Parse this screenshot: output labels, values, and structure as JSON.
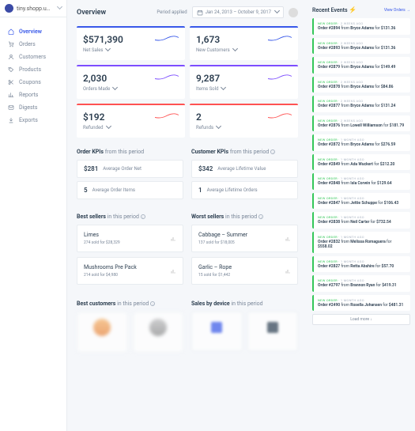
{
  "site": "tiny.shopp.u…",
  "nav": [
    {
      "label": "Overview",
      "icon": "home"
    },
    {
      "label": "Orders",
      "icon": "cart"
    },
    {
      "label": "Customers",
      "icon": "user"
    },
    {
      "label": "Products",
      "icon": "tag"
    },
    {
      "label": "Coupons",
      "icon": "cut"
    },
    {
      "label": "Reports",
      "icon": "chart"
    },
    {
      "label": "Digests",
      "icon": "mail"
    },
    {
      "label": "Exports",
      "icon": "download"
    }
  ],
  "header": {
    "title": "Overview",
    "period_label": "Period applied",
    "date_range": "Jan 24, 2013 – October 9, 2017"
  },
  "chart_data": {
    "type": "table",
    "title": "Overview metrics",
    "series": [
      {
        "name": "Net Sales",
        "value": 571390,
        "display": "$571,390",
        "color": "#3858e9"
      },
      {
        "name": "New Customers",
        "value": 1673,
        "display": "1,673",
        "color": "#3858e9"
      },
      {
        "name": "Orders Made",
        "value": 2030,
        "display": "2,030",
        "color": "#7c4dff"
      },
      {
        "name": "Items Sold",
        "value": 9287,
        "display": "9,287",
        "color": "#7c4dff"
      },
      {
        "name": "Refunded",
        "value": 192,
        "display": "$192",
        "color": "#ff5252"
      },
      {
        "name": "Refunds",
        "value": 2,
        "display": "2",
        "color": "#ff5252"
      }
    ]
  },
  "sections": {
    "order_kpis": {
      "title": "Order KPIs",
      "sub": "from this period",
      "items": [
        {
          "val": "$281",
          "lbl": "Average Order Net"
        },
        {
          "val": "5",
          "lbl": "Average Order Items"
        }
      ]
    },
    "customer_kpis": {
      "title": "Customer KPIs",
      "sub": "from this period",
      "items": [
        {
          "val": "$342",
          "lbl": "Average Lifetime Value"
        },
        {
          "val": "1",
          "lbl": "Average Lifetime Orders"
        }
      ]
    },
    "best_sellers": {
      "title": "Best sellers",
      "sub": "in this period",
      "items": [
        {
          "name": "Limes",
          "stat": "274 sold for $28,329"
        },
        {
          "name": "Mushrooms Pre Pack",
          "stat": "214 sold for $4,980"
        }
      ]
    },
    "worst_sellers": {
      "title": "Worst sellers",
      "sub": "in this period",
      "items": [
        {
          "name": "Cabbage – Summer",
          "stat": "137 sold for $18,005"
        },
        {
          "name": "Garlic – Rope",
          "stat": "15 sold for $1,442"
        }
      ]
    },
    "best_customers": {
      "title": "Best customers",
      "sub": "in this period"
    },
    "sales_by_device": {
      "title": "Sales by device",
      "sub": "in this period"
    }
  },
  "events": {
    "title": "Recent Events",
    "view_link": "View Orders →",
    "tag": "NEW ORDER",
    "load_more": "Load more ↓",
    "items": [
      {
        "time": "2 WEEKS AGO",
        "txt": "Order #2894 from Bryce Adams for $131.36"
      },
      {
        "time": "2 WEEKS AGO",
        "txt": "Order #2893 from Bryce Adams for $131.36"
      },
      {
        "time": "2 WEEKS AGO",
        "txt": "Order #2879 from Bryce Adams for $149.49"
      },
      {
        "time": "2 WEEKS AGO",
        "txt": "Order #2878 from Bryce Adams for $84.86"
      },
      {
        "time": "2 WEEKS AGO",
        "txt": "Order #2877 from Bryce Adams for $131.24"
      },
      {
        "time": "2 WEEKS AGO",
        "txt": "Order #2876 from Lowell Williamson for $181.79"
      },
      {
        "time": "1 MONTH AGO",
        "txt": "Order #2872 from Bryce Adams for $276.59"
      },
      {
        "time": "1 MONTH AGO",
        "txt": "Order #2849 from Ada Wuckert for $212.20"
      },
      {
        "time": "1 MONTH AGO",
        "txt": "Order #2848 from Isla Corwin for $129.64"
      },
      {
        "time": "1 MONTH AGO",
        "txt": "Order #2847 from Jettie Schuppe for $106.43"
      },
      {
        "time": "1 MONTH AGO",
        "txt": "Order #2838 from Neil Carter for $732.54"
      },
      {
        "time": "1 MONTH AGO",
        "txt": "Order #2832 from Melissa Romaguera for $558.02"
      },
      {
        "time": "1 MONTH AGO",
        "txt": "Order #2827 from Retta Abshire for $57.70"
      },
      {
        "time": "1 MONTH AGO",
        "txt": "Order #2797 from Brannon Ryan for $419.31"
      },
      {
        "time": "1 MONTH AGO",
        "txt": "Order #2490 from Rosella Johansen for $481.31"
      }
    ]
  }
}
